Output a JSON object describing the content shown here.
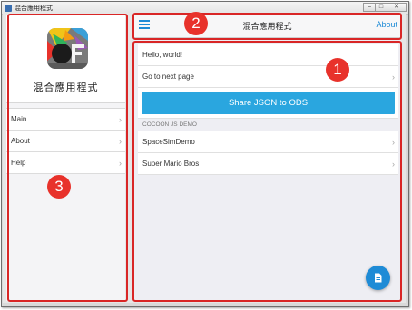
{
  "window": {
    "title": "混合應用程式",
    "controls": [
      "–",
      "□",
      "✕"
    ]
  },
  "sidebar": {
    "app_name": "混合應用程式",
    "items": [
      {
        "label": "Main"
      },
      {
        "label": "About"
      },
      {
        "label": "Help"
      }
    ]
  },
  "navbar": {
    "menu_icon": "hamburger-icon",
    "title": "混合應用程式",
    "about_label": "About"
  },
  "content": {
    "items": [
      {
        "label": "Hello, world!"
      },
      {
        "label": "Go to next page"
      }
    ],
    "share_button": "Share JSON to ODS",
    "section_header": "COCOON JS DEMO",
    "demos": [
      {
        "label": "SpaceSimDemo"
      },
      {
        "label": "Super Mario Bros"
      }
    ],
    "fab_icon": "document-icon"
  },
  "annotations": [
    "1",
    "2",
    "3"
  ],
  "colors": {
    "accent": "#1e8bd6",
    "button": "#2aa6df",
    "annotation": "#e8322b"
  }
}
